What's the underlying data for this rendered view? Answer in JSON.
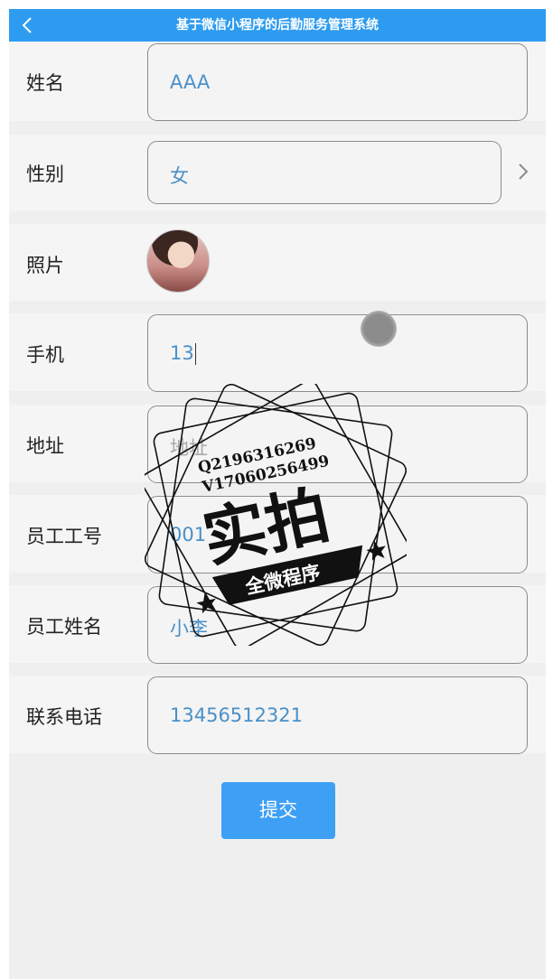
{
  "header": {
    "title": "基于微信小程序的后勤服务管理系统"
  },
  "form": {
    "name": {
      "label": "姓名",
      "value": "AAA"
    },
    "gender": {
      "label": "性别",
      "value": "女"
    },
    "photo": {
      "label": "照片"
    },
    "phone": {
      "label": "手机",
      "value": "13"
    },
    "address": {
      "label": "地址",
      "placeholder": "地址"
    },
    "emp_no": {
      "label": "员工工号",
      "value": "001"
    },
    "emp_name": {
      "label": "员工姓名",
      "value": "小李"
    },
    "contact": {
      "label": "联系电话",
      "value": "13456512321"
    }
  },
  "submit_label": "提交",
  "watermark": {
    "line1": "Q2196316269",
    "line2": "V17060256499",
    "main": "实拍",
    "banner": "全微程序"
  },
  "colors": {
    "header": "#2d9bf0",
    "value_text": "#4a90c8",
    "button": "#3ea0f5"
  },
  "icons": [
    "back-arrow-icon",
    "chevron-right-icon"
  ]
}
